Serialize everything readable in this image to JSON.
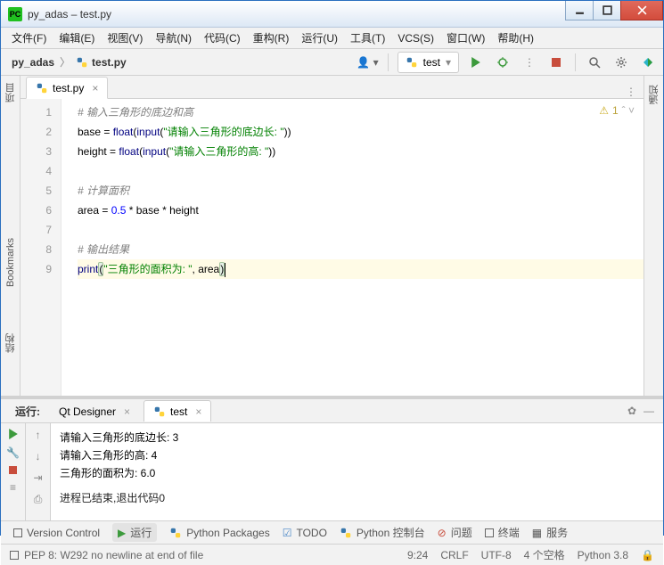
{
  "window": {
    "title": "py_adas – test.py"
  },
  "menu": [
    "文件(F)",
    "编辑(E)",
    "视图(V)",
    "导航(N)",
    "代码(C)",
    "重构(R)",
    "运行(U)",
    "工具(T)",
    "VCS(S)",
    "窗口(W)",
    "帮助(H)"
  ],
  "breadcrumb": {
    "project": "py_adas",
    "file": "test.py"
  },
  "runconfig": {
    "label": "test"
  },
  "tab": {
    "name": "test.py"
  },
  "warning": {
    "count": "1"
  },
  "code": {
    "l1": "# 输入三角形的底边和高",
    "l2a": "base = ",
    "l2b": "float",
    "l2c": "input",
    "l2d": "\"请输入三角形的底边长: \"",
    "l3a": "height = ",
    "l3b": "float",
    "l3c": "input",
    "l3d": "\"请输入三角形的高: \"",
    "l5": "# 计算面积",
    "l6a": "area = ",
    "l6b": "0.5",
    "l6c": " * base * height",
    "l8": "# 输出结果",
    "l9a": "print",
    "l9b": "\"三角形的面积为: \"",
    "l9c": ", area"
  },
  "run": {
    "label": "运行:",
    "tabs": [
      "Qt Designer",
      "test"
    ],
    "out1": "请输入三角形的底边长: 3",
    "out2": "请输入三角形的高: 4",
    "out3": "三角形的面积为:  6.0",
    "exit": "进程已结束,退出代码0"
  },
  "bottom": [
    "Version Control",
    "运行",
    "Python Packages",
    "TODO",
    "Python 控制台",
    "问题",
    "终端",
    "服务"
  ],
  "status": {
    "pep": "PEP 8: W292 no newline at end of file",
    "pos": "9:24",
    "crlf": "CRLF",
    "enc": "UTF-8",
    "indent": "4 个空格",
    "py": "Python 3.8"
  },
  "sidebars": {
    "left1": "项目",
    "left2": "Bookmarks",
    "left3": "结构",
    "right": "通知"
  }
}
